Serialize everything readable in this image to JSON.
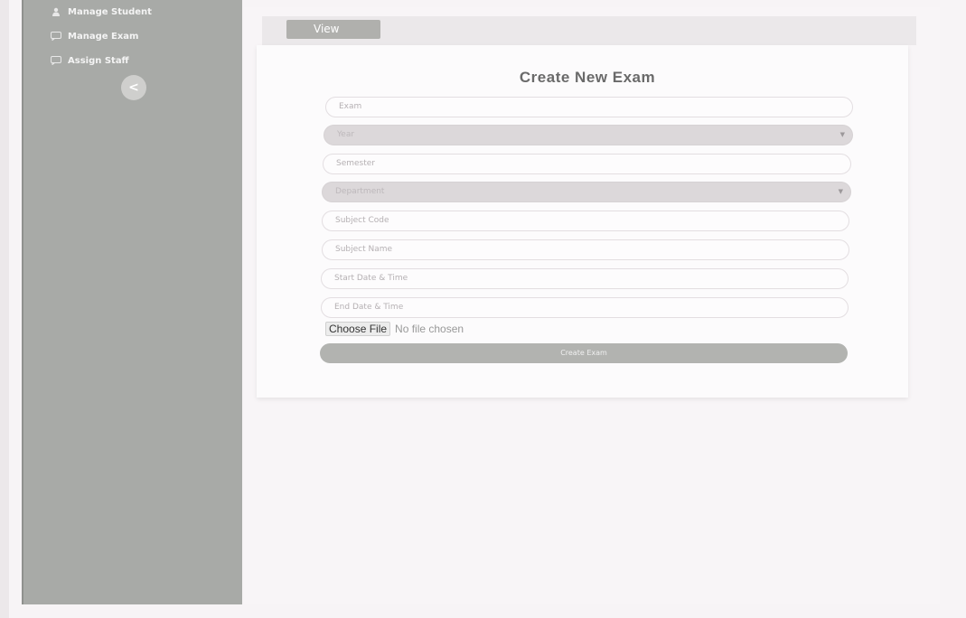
{
  "sidebar": {
    "items": [
      {
        "label": "Manage Student",
        "icon": "person-icon"
      },
      {
        "label": "Manage Exam",
        "icon": "chat-icon"
      },
      {
        "label": "Assign Staff",
        "icon": "chat-icon"
      }
    ],
    "collapse_label": "<"
  },
  "header": {
    "view_tab": "View"
  },
  "form": {
    "title": "Create New Exam",
    "fields": {
      "exam": "Exam",
      "year": "Year",
      "semester": "Semester",
      "department": "Department",
      "subject_code": "Subject Code",
      "subject_name": "Subject Name",
      "start": "Start Date & Time",
      "end": "End Date & Time"
    },
    "file_button": "Choose File",
    "file_status": "No file chosen",
    "submit": "Create Exam"
  },
  "colors": {
    "sidebar": "#a8aaa7",
    "button": "#b2b3b0",
    "background": "#f7f4f6"
  }
}
